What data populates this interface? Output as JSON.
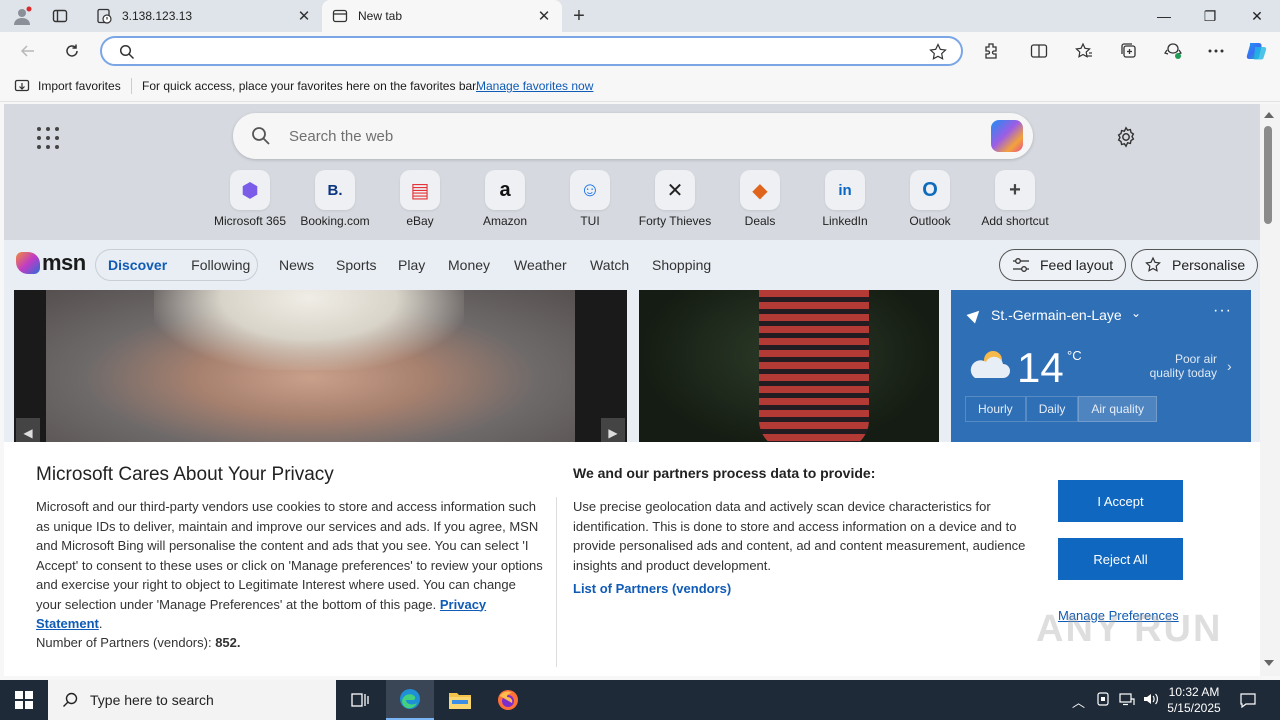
{
  "tabs": [
    {
      "title": "3.138.123.13",
      "close": "✕"
    },
    {
      "title": "New tab",
      "close": "✕"
    }
  ],
  "new_tab_symbol": "+",
  "window_controls": {
    "minimize": "—",
    "restore": "❐",
    "close": "✕"
  },
  "address_bar": {
    "value": "",
    "placeholder": ""
  },
  "favorites_bar": {
    "import_label": "Import favorites",
    "message": "For quick access, place your favorites here on the favorites bar.",
    "link": "Manage favorites now"
  },
  "search": {
    "placeholder": "Search the web"
  },
  "shortcuts": [
    {
      "label": "Microsoft 365",
      "icon": "microsoft-365-icon",
      "glyph": "⬢",
      "color": "#7b5ce8"
    },
    {
      "label": "Booking.com",
      "icon": "booking-icon",
      "glyph": "B.",
      "color": "#0b3580"
    },
    {
      "label": "eBay",
      "icon": "ebay-icon",
      "glyph": "▤",
      "color": "#e53238"
    },
    {
      "label": "Amazon",
      "icon": "amazon-icon",
      "glyph": "a",
      "color": "#111111"
    },
    {
      "label": "TUI",
      "icon": "tui-icon",
      "glyph": "☺",
      "color": "#1a73e8"
    },
    {
      "label": "Forty Thieves",
      "icon": "forty-thieves-icon",
      "glyph": "✕",
      "color": "#222222"
    },
    {
      "label": "Deals",
      "icon": "deals-icon",
      "glyph": "◆",
      "color": "#e0641b"
    },
    {
      "label": "LinkedIn",
      "icon": "linkedin-icon",
      "glyph": "in",
      "color": "#0a66c2"
    },
    {
      "label": "Outlook",
      "icon": "outlook-icon",
      "glyph": "O",
      "color": "#0f6cbd"
    },
    {
      "label": "Add shortcut",
      "icon": "add-shortcut-icon",
      "glyph": "+",
      "color": "#444444"
    }
  ],
  "msn": {
    "logo": "msn",
    "segment": {
      "active": "Discover",
      "other": "Following"
    },
    "nav": [
      "News",
      "Sports",
      "Play",
      "Money",
      "Weather",
      "Watch",
      "Shopping"
    ],
    "feed_layout": "Feed layout",
    "personalise": "Personalise"
  },
  "weather": {
    "location": "St.-Germain-en-Laye",
    "temperature": "14",
    "unit": "°C",
    "air_quality": "Poor air quality today",
    "tabs": [
      "Hourly",
      "Daily",
      "Air quality"
    ],
    "selected_tab": "Air quality"
  },
  "privacy": {
    "title": "Microsoft Cares About Your Privacy",
    "body": "Microsoft and our third-party vendors use cookies to store and access information such as unique IDs to deliver, maintain and improve our services and ads. If you agree, MSN and Microsoft Bing will personalise the content and ads that you see. You can select 'I Accept' to consent to these uses or click on 'Manage preferences' to review your options and exercise your right to object to Legitimate Interest where used.  You can change your selection under 'Manage Preferences' at the bottom of this page.",
    "statement_link": "Privacy Statement",
    "partners_label": "Number of Partners (vendors):",
    "partners_count": "852.",
    "right_title": "We and our partners process data to provide:",
    "right_body": "Use precise geolocation data and actively scan device characteristics for identification. This is done to store and access information on a device and to provide personalised ads and content, ad and content measurement, audience insights and product development.",
    "list_link": "List of Partners (vendors)",
    "accept": "I Accept",
    "reject": "Reject All",
    "manage": "Manage Preferences"
  },
  "watermark": "ANY RUN",
  "taskbar": {
    "search_placeholder": "Type here to search",
    "time": "10:32 AM",
    "date": "5/15/2025"
  }
}
